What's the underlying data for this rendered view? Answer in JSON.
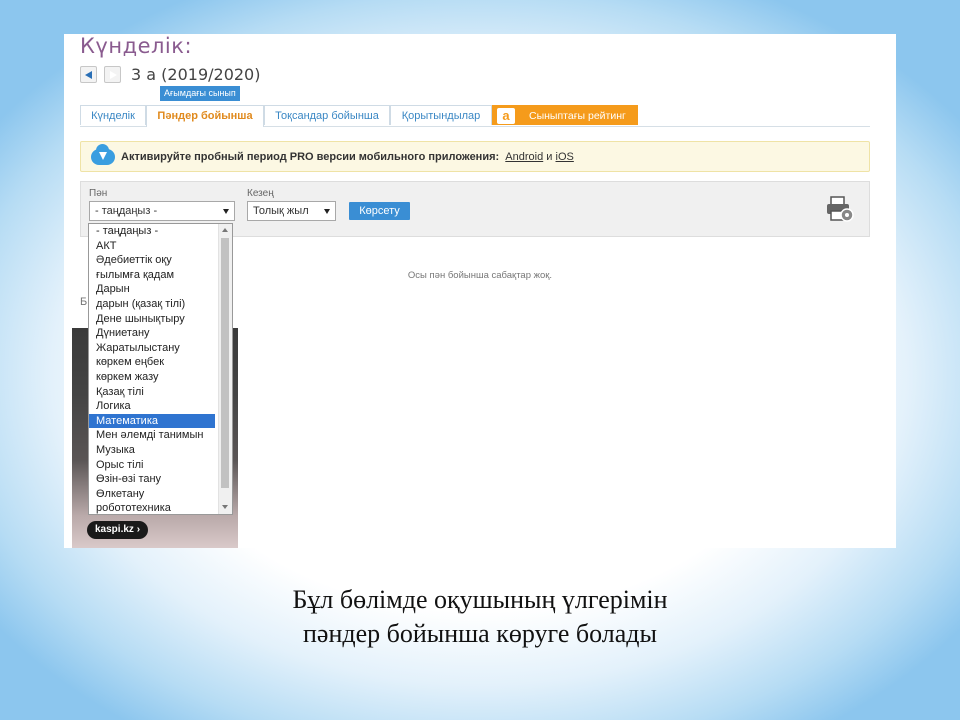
{
  "page": {
    "title": "Күнделік:",
    "class_label": "3 а (2019/2020)",
    "badge": "Ағымдағы сынып"
  },
  "tabs": [
    {
      "label": "Күнделік",
      "active": false
    },
    {
      "label": "Пәндер бойынша",
      "active": true
    },
    {
      "label": "Тоқсандар бойынша",
      "active": false
    },
    {
      "label": "Қорытындылар",
      "active": false
    },
    {
      "label": "Сыныптағы рейтинг",
      "active": false,
      "logo": "a"
    }
  ],
  "banner": {
    "icon": "cloud-download-icon",
    "text": "Активируйте пробный период PRO версии мобильного приложения:",
    "android": "Android",
    "and": "и",
    "ios": "iOS"
  },
  "filters": {
    "subject_label": "Пән",
    "subject_value": "- таңдаңыз -",
    "period_label": "Кезең",
    "period_value": "Толық жыл",
    "show_button": "Көрсету",
    "print_icon": "print-settings-icon"
  },
  "dropdown": {
    "options": [
      "- таңдаңыз -",
      "АКТ",
      "Әдебиеттік оқу",
      "ғылымға қадам",
      "Дарын",
      "дарын (қазақ тілі)",
      "Дене шынықтыру",
      "Дүниетану",
      "Жаратылыстану",
      "көркем еңбек",
      "көркем жазу",
      "Қазақ тілі",
      "Логика",
      "Математика",
      "Мен әлемді танимын",
      "Музыка",
      "Орыс тілі",
      "Өзін-өзі тану",
      "Өлкетану",
      "робототехника"
    ],
    "highlighted": "Математика"
  },
  "empty_message": "Осы пән бойынша сабақтар жоқ.",
  "partial_text": "Б",
  "ad": {
    "label": "kaspi.kz ›"
  },
  "caption": {
    "line1": "Бұл бөлімде оқушының үлгерімін",
    "line2": "пәндер бойынша көруге  болады"
  },
  "colors": {
    "accent": "#3a8ed4",
    "active_tab": "#e08a1e",
    "rating_tab": "#f59b1b",
    "title": "#8a5b8f",
    "banner_bg": "#fcf8e3"
  }
}
